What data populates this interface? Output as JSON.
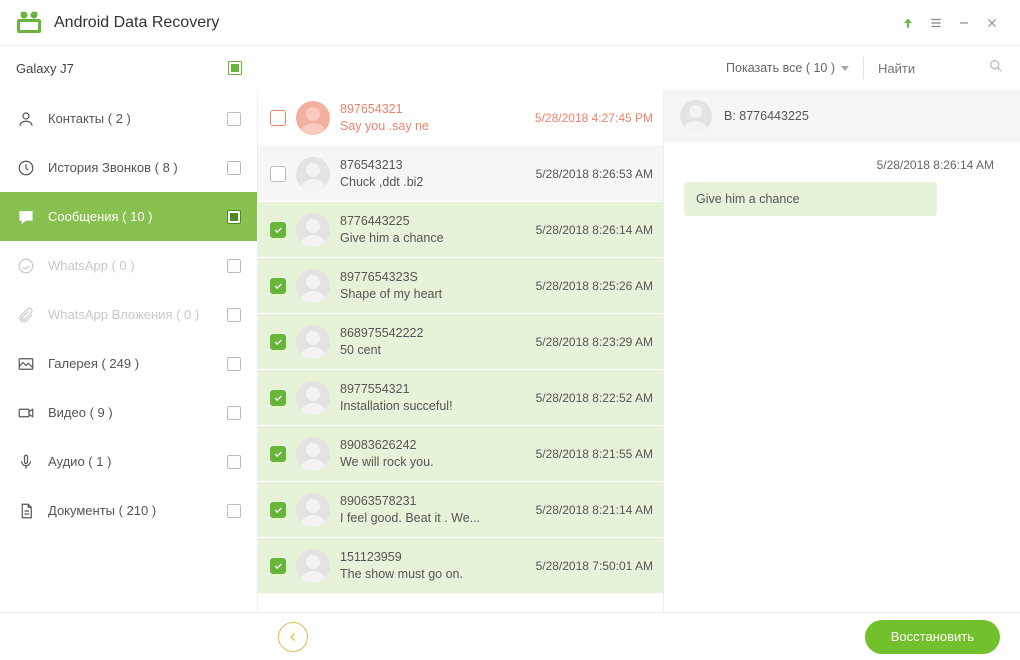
{
  "app_title": "Android Data Recovery",
  "device_name": "Galaxy J7",
  "filter_label": "Показать все ( 10 )",
  "search_placeholder": "Найти",
  "sidebar": [
    {
      "key": "contacts",
      "label": "Контакты ( 2 )",
      "active": false,
      "disabled": false,
      "checked": false
    },
    {
      "key": "calls",
      "label": "История Звонков ( 8 )",
      "active": false,
      "disabled": false,
      "checked": false
    },
    {
      "key": "messages",
      "label": "Сообщения ( 10 )",
      "active": true,
      "disabled": false,
      "checked": true
    },
    {
      "key": "whatsapp",
      "label": "WhatsApp ( 0 )",
      "active": false,
      "disabled": true,
      "checked": false
    },
    {
      "key": "waattach",
      "label": "WhatsApp Вложения ( 0 )",
      "active": false,
      "disabled": true,
      "checked": false
    },
    {
      "key": "gallery",
      "label": "Галерея ( 249 )",
      "active": false,
      "disabled": false,
      "checked": false
    },
    {
      "key": "video",
      "label": "Видео ( 9 )",
      "active": false,
      "disabled": false,
      "checked": false
    },
    {
      "key": "audio",
      "label": "Аудио ( 1 )",
      "active": false,
      "disabled": false,
      "checked": false
    },
    {
      "key": "docs",
      "label": "Документы ( 210 )",
      "active": false,
      "disabled": false,
      "checked": false
    }
  ],
  "messages": [
    {
      "number": "897654321",
      "preview": "Say you .say ne",
      "time": "5/28/2018 4:27:45 PM",
      "checked": false,
      "variant": "first"
    },
    {
      "number": "876543213",
      "preview": "Chuck ,ddt .bi2",
      "time": "5/28/2018 8:26:53 AM",
      "checked": false,
      "variant": "unsel"
    },
    {
      "number": "8776443225",
      "preview": "Give him a chance",
      "time": "5/28/2018 8:26:14 AM",
      "checked": true,
      "variant": "sel"
    },
    {
      "number": "8977654323S",
      "preview": "Shape of my heart",
      "time": "5/28/2018 8:25:26 AM",
      "checked": true,
      "variant": "sel"
    },
    {
      "number": "868975542222",
      "preview": "50 cent",
      "time": "5/28/2018 8:23:29 AM",
      "checked": true,
      "variant": "sel"
    },
    {
      "number": "8977554321",
      "preview": "Installation  succeful!",
      "time": "5/28/2018 8:22:52 AM",
      "checked": true,
      "variant": "sel"
    },
    {
      "number": "89083626242",
      "preview": "We will rock you.",
      "time": "5/28/2018 8:21:55 AM",
      "checked": true,
      "variant": "sel"
    },
    {
      "number": "89063578231",
      "preview": "I feel good. Beat it . We...",
      "time": "5/28/2018 8:21:14 AM",
      "checked": true,
      "variant": "sel"
    },
    {
      "number": "151123959",
      "preview": "The show must go on.",
      "time": "5/28/2018 7:50:01 AM",
      "checked": true,
      "variant": "sel"
    }
  ],
  "thread": {
    "contact_label": "B: 8776443225",
    "timestamp": "5/28/2018 8:26:14 AM",
    "bubble_text": "Give him a chance"
  },
  "recover_label": "Восстановить"
}
